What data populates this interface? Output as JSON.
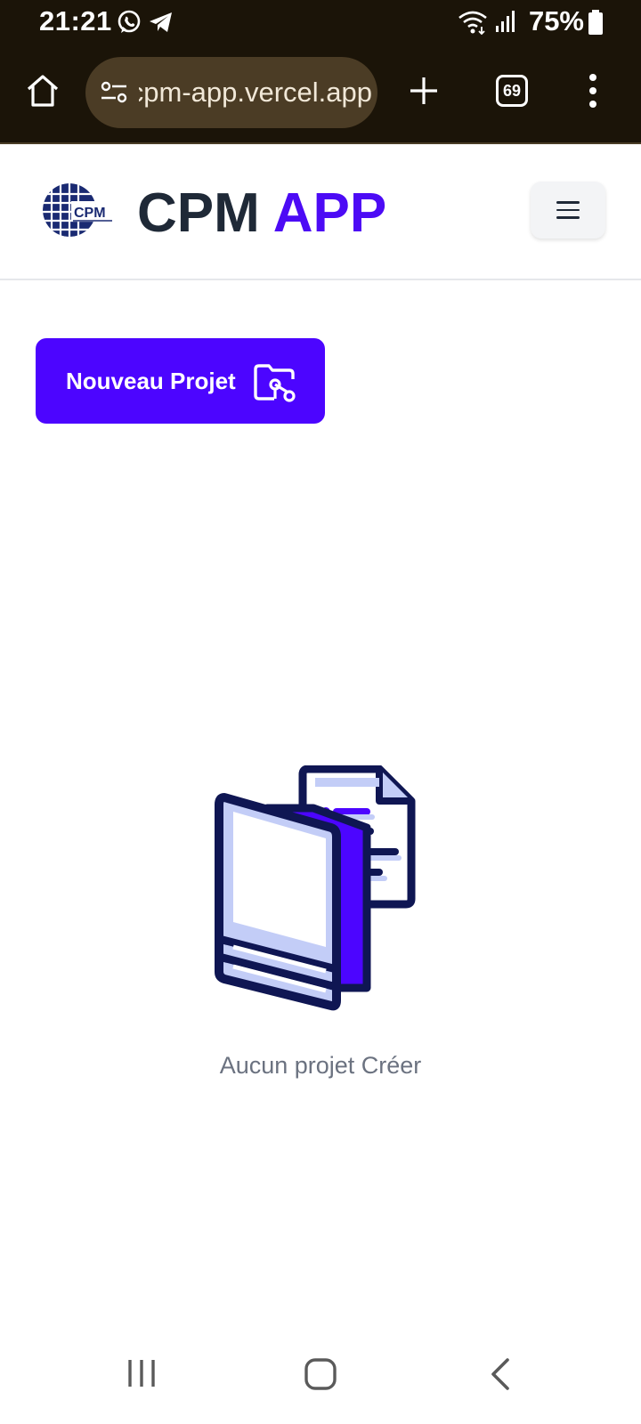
{
  "status_bar": {
    "time": "21:21",
    "battery": "75%",
    "icons": [
      "whatsapp-icon",
      "telegram-icon",
      "wifi-icon",
      "signal-icon",
      "battery-icon"
    ]
  },
  "browser": {
    "url": "cpm-app.vercel.app",
    "tab_count": "69",
    "icons": [
      "home-icon",
      "site-settings-icon",
      "new-tab-icon",
      "tab-switcher-icon",
      "more-vert-icon"
    ]
  },
  "header": {
    "brand_main": "CPM",
    "brand_accent": "APP",
    "logo_text": "CPM",
    "menu_icon": "hamburger-menu-icon"
  },
  "main": {
    "new_project_label": "Nouveau Projet",
    "new_project_icon": "folder-search-icon",
    "empty_state_text": "Aucun projet Créer",
    "empty_state_icon": "empty-folder-document-illustration"
  },
  "colors": {
    "accent": "#4c05ff",
    "brand_dark": "#1f2937",
    "browser_bg": "#1b1408",
    "navy": "#0f1653",
    "light_blue": "#c3cdf7"
  },
  "nav_bar": {
    "icons": [
      "recent-apps-icon",
      "home-nav-icon",
      "back-icon"
    ]
  }
}
